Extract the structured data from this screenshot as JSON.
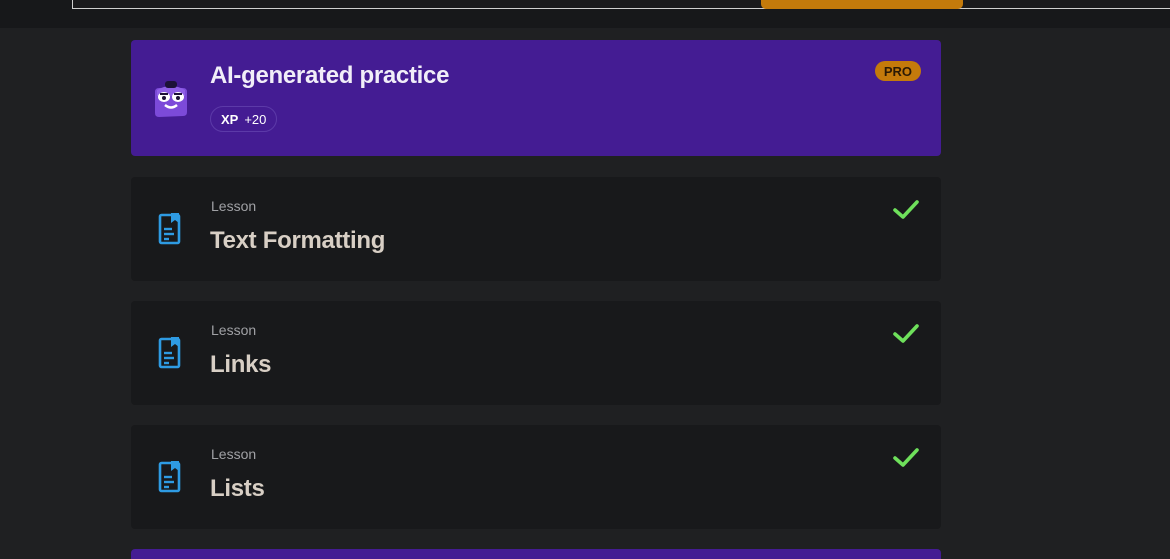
{
  "colors": {
    "page_bg": "#1f2022",
    "practice_bg": "#441c93",
    "lesson_bg": "#18191b",
    "pro_badge": "#c47a0b",
    "check": "#6ee05b",
    "lesson_icon": "#2e9be3"
  },
  "practice": {
    "title": "AI-generated practice",
    "xp_label": "XP",
    "xp_value": "+20",
    "pro_label": "PRO",
    "icon": "mascot-icon"
  },
  "lessons": [
    {
      "kind": "Lesson",
      "title": "Text Formatting",
      "completed": true,
      "icon": "lesson-document-icon"
    },
    {
      "kind": "Lesson",
      "title": "Links",
      "completed": true,
      "icon": "lesson-document-icon"
    },
    {
      "kind": "Lesson",
      "title": "Lists",
      "completed": true,
      "icon": "lesson-document-icon"
    }
  ]
}
